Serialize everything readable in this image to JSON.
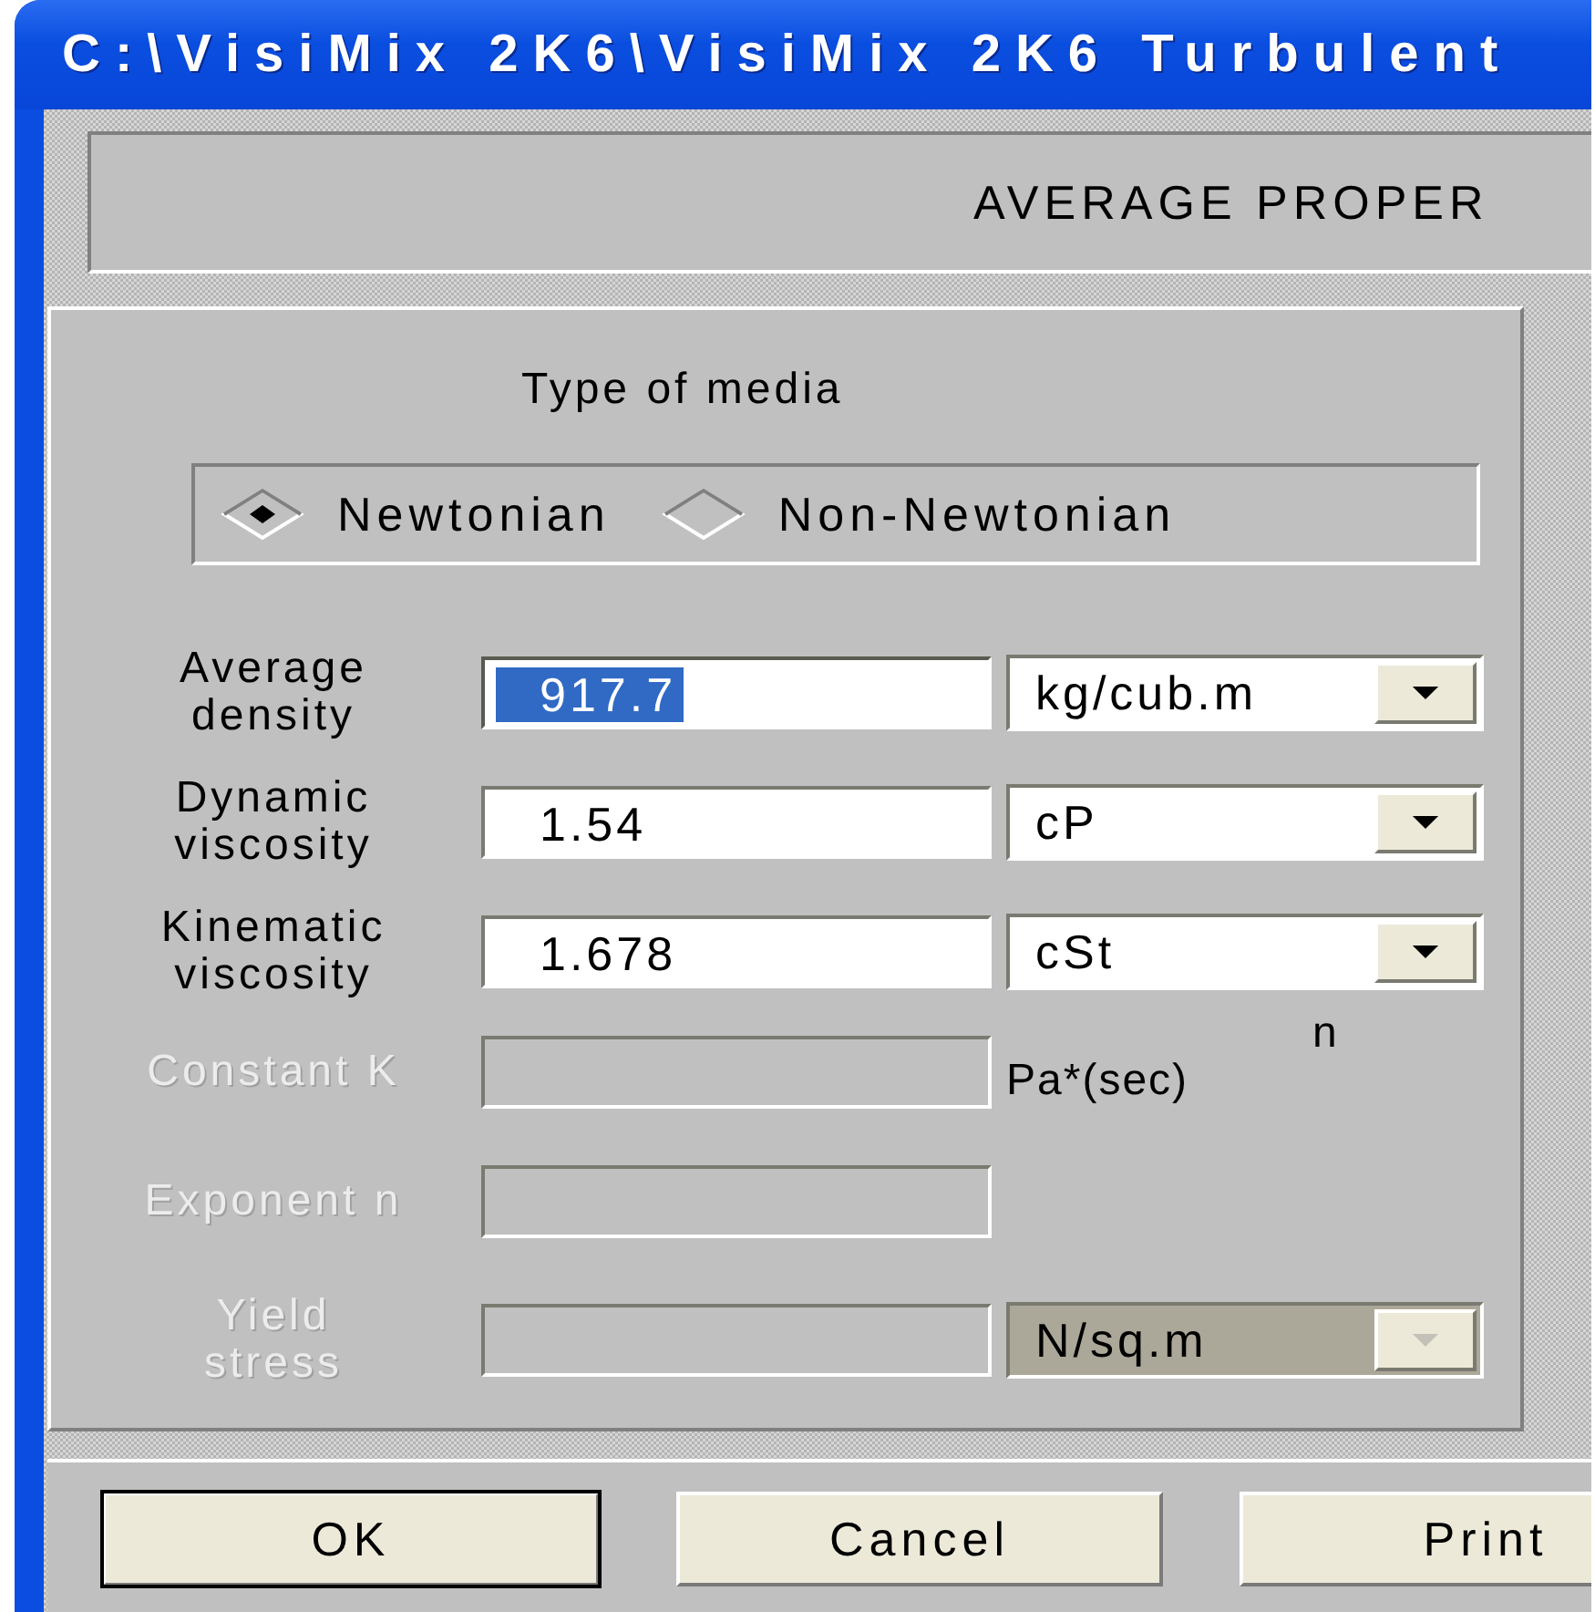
{
  "window": {
    "title": "C:\\VisiMix 2K6\\VisiMix 2K6 Turbulent"
  },
  "header": {
    "title": "AVERAGE PROPER"
  },
  "media_type": {
    "label": "Type of media",
    "options": [
      {
        "label": "Newtonian",
        "selected": true
      },
      {
        "label": "Non-Newtonian",
        "selected": false
      }
    ]
  },
  "properties": [
    {
      "label": "Average\ndensity",
      "value": "917.7",
      "highlighted": true,
      "disabled": false,
      "unit": {
        "kind": "dropdown",
        "text": "kg/cub.m"
      }
    },
    {
      "label": "Dynamic\nviscosity",
      "value": "1.54",
      "highlighted": false,
      "disabled": false,
      "unit": {
        "kind": "dropdown",
        "text": "cP"
      }
    },
    {
      "label": "Kinematic\nviscosity",
      "value": "1.678",
      "highlighted": false,
      "disabled": false,
      "unit": {
        "kind": "dropdown",
        "text": "cSt"
      }
    },
    {
      "label": "Constant K",
      "highlighted": false,
      "disabled": true,
      "unit": {
        "kind": "label",
        "text": "Pa*(sec)",
        "superscript": "n"
      }
    },
    {
      "label": "Exponent n",
      "highlighted": false,
      "disabled": true
    },
    {
      "label": "Yield\nstress",
      "highlighted": false,
      "disabled": true,
      "unit": {
        "kind": "dropdown",
        "text": "N/sq.m"
      }
    }
  ],
  "buttons": [
    {
      "label": "OK",
      "default": true
    },
    {
      "label": "Cancel",
      "default": false
    },
    {
      "label": "Print",
      "default": false
    }
  ]
}
